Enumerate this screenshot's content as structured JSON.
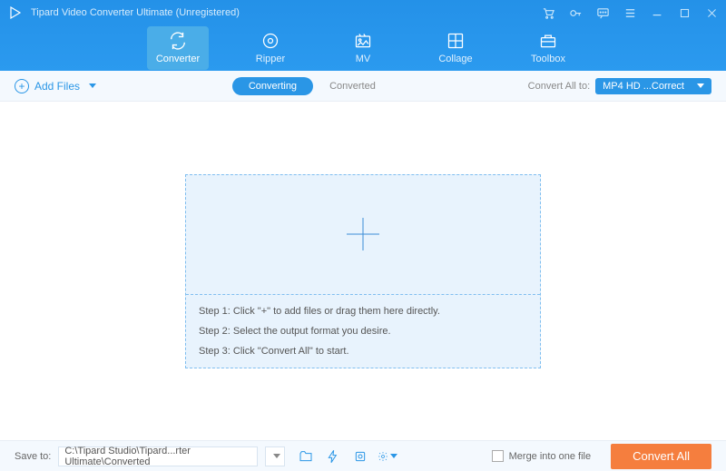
{
  "window": {
    "title": "Tipard Video Converter Ultimate (Unregistered)"
  },
  "nav": {
    "tabs": [
      {
        "label": "Converter"
      },
      {
        "label": "Ripper"
      },
      {
        "label": "MV"
      },
      {
        "label": "Collage"
      },
      {
        "label": "Toolbox"
      }
    ]
  },
  "toolbar": {
    "add_files_label": "Add Files",
    "pill_converting": "Converting",
    "pill_converted": "Converted",
    "convert_all_to_label": "Convert All to:",
    "format_selected": "MP4 HD ...Correct"
  },
  "dropzone": {
    "steps": [
      "Step 1: Click \"+\" to add files or drag them here directly.",
      "Step 2: Select the output format you desire.",
      "Step 3: Click \"Convert All\" to start."
    ]
  },
  "footer": {
    "save_to_label": "Save to:",
    "save_path": "C:\\Tipard Studio\\Tipard...rter Ultimate\\Converted",
    "merge_label": "Merge into one file",
    "convert_button": "Convert All"
  }
}
